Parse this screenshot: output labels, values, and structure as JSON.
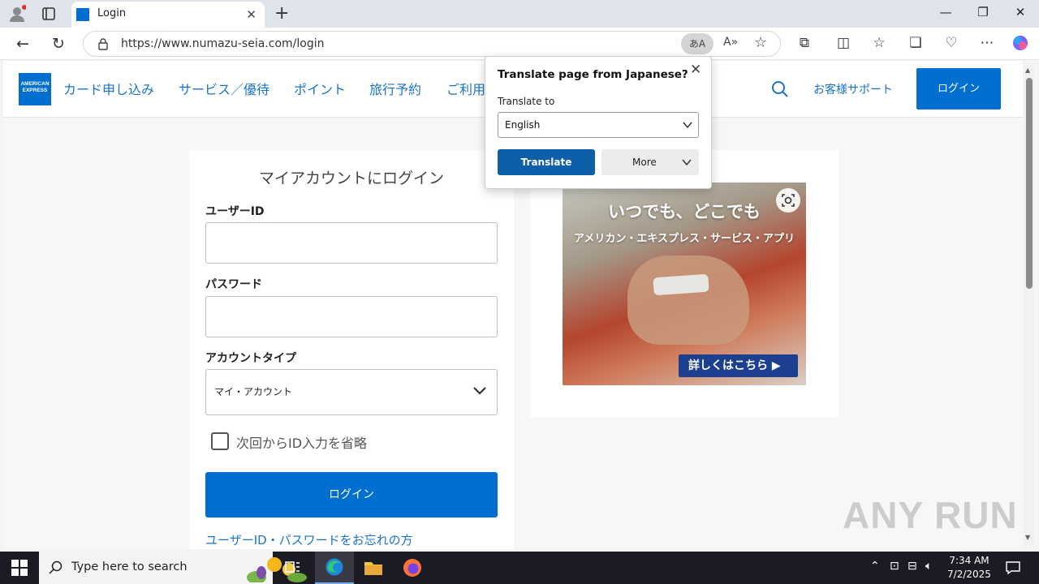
{
  "browser": {
    "tab_title": "Login",
    "url": "https://www.numazu-seia.com/login",
    "translate_badge": "あ"
  },
  "site": {
    "logo_text": "AMERICAN EXPRESS",
    "nav": [
      "カード申し込み",
      "サービス／優待",
      "ポイント",
      "旅行予約",
      "ご利用"
    ],
    "support": "お客様サポート",
    "header_login": "ログイン"
  },
  "login": {
    "title": "マイアカウントにログイン",
    "user_id_label": "ユーザーID",
    "password_label": "パスワード",
    "account_type_label": "アカウントタイプ",
    "account_type_value": "マイ・アカウント",
    "remember_label": "次回からID入力を省略",
    "submit": "ログイン",
    "forgot": "ユーザーID・パスワードをお忘れの方"
  },
  "promo": {
    "headline": "いつでも、どこでも",
    "subline": "アメリカン・エキスプレス・サービス・アプリ",
    "cta": "詳しくはこちら ▶"
  },
  "translate_popup": {
    "title": "Translate page from Japanese?",
    "translate_to_label": "Translate to",
    "language": "English",
    "translate_button": "Translate",
    "more_button": "More"
  },
  "watermark": "ANY RUN",
  "taskbar": {
    "search_placeholder": "Type here to search",
    "time": "7:34 AM",
    "date": "7/2/2025"
  },
  "colors": {
    "brand_blue": "#006fcf",
    "link_blue": "#1a73c9",
    "translate_blue": "#0f5ea8"
  }
}
